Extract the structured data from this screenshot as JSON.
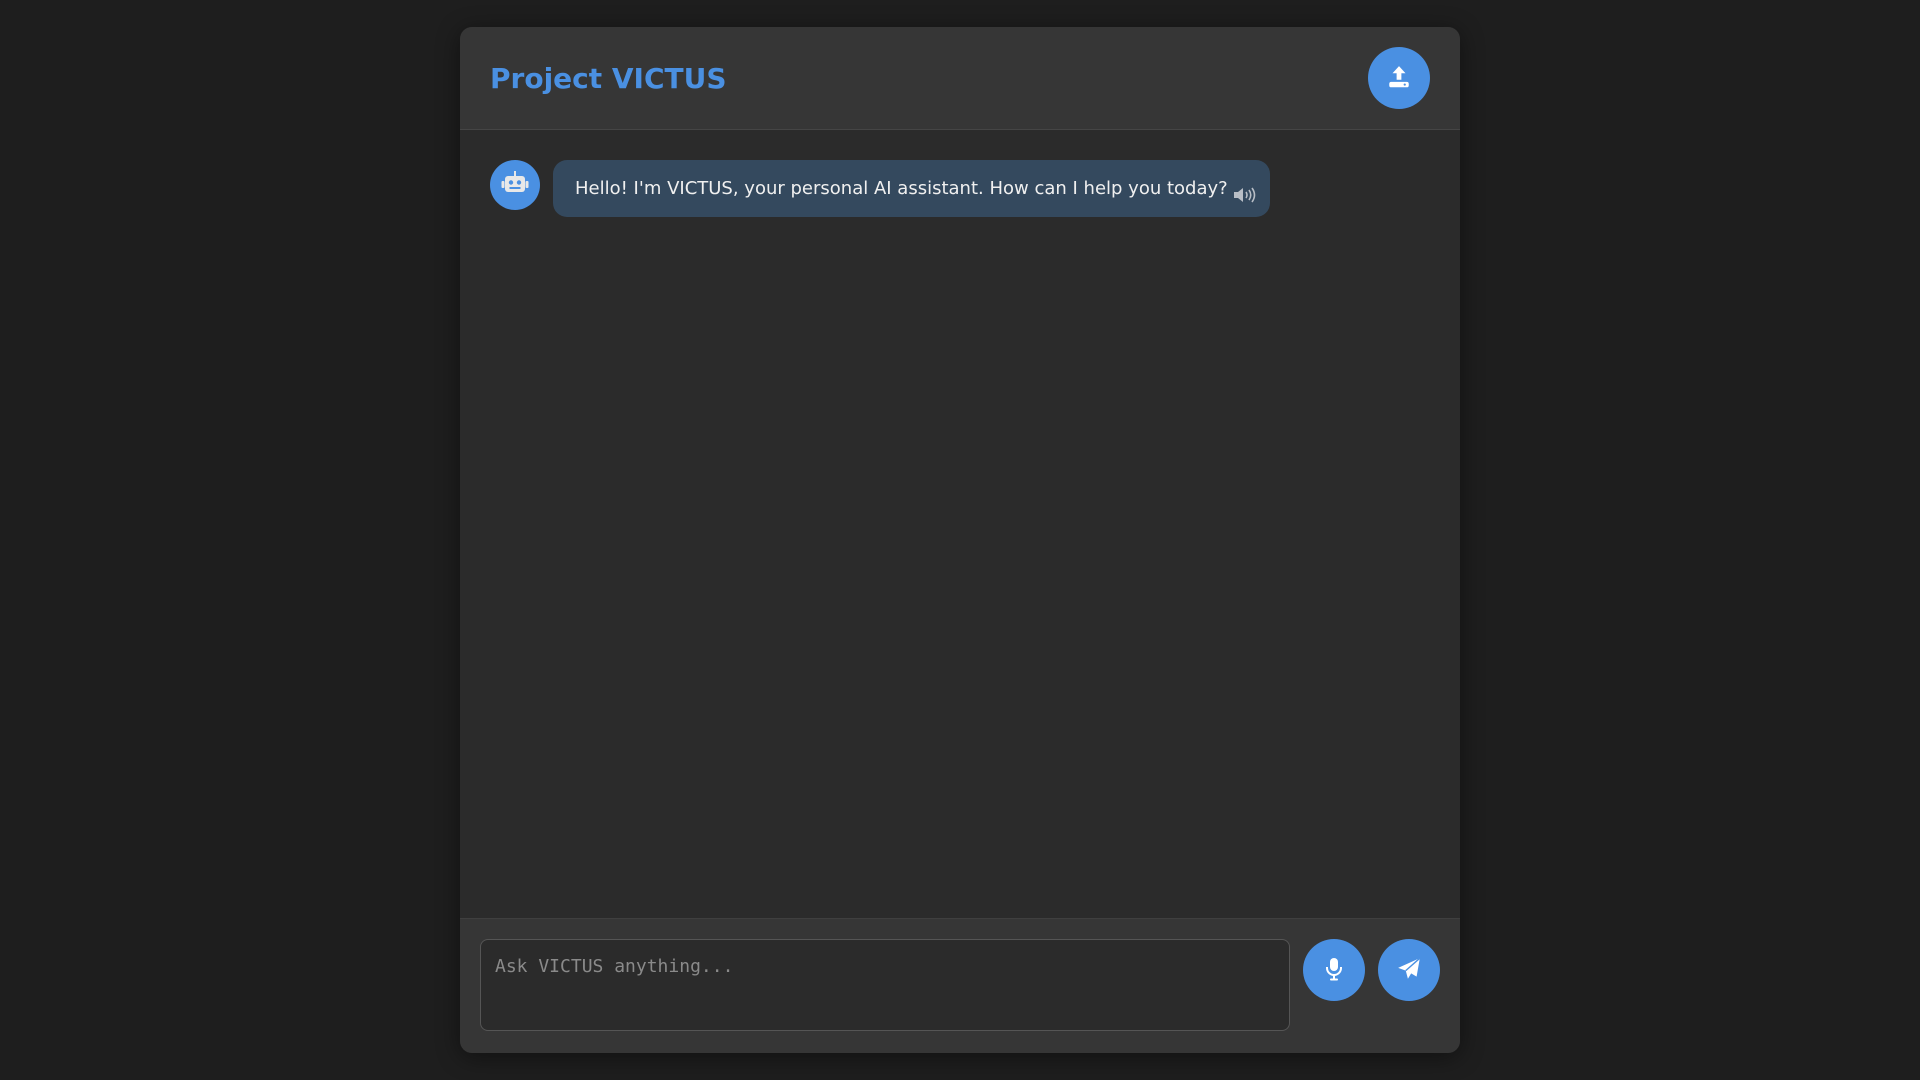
{
  "header": {
    "title": "Project VICTUS",
    "upload_icon": "upload-icon"
  },
  "messages": [
    {
      "sender": "assistant",
      "avatar_icon": "robot-icon",
      "text": "Hello! I'm VICTUS, your personal AI assistant. How can I help you today?",
      "speak_icon": "speaker-icon"
    }
  ],
  "composer": {
    "placeholder": "Ask VICTUS anything...",
    "value": "",
    "mic_icon": "microphone-icon",
    "send_icon": "send-icon"
  },
  "colors": {
    "accent": "#4a90e2",
    "page_background": "#1e1e1e",
    "window_background": "#2b2b2b",
    "header_background": "#363636",
    "bubble_background": "#34495e"
  }
}
